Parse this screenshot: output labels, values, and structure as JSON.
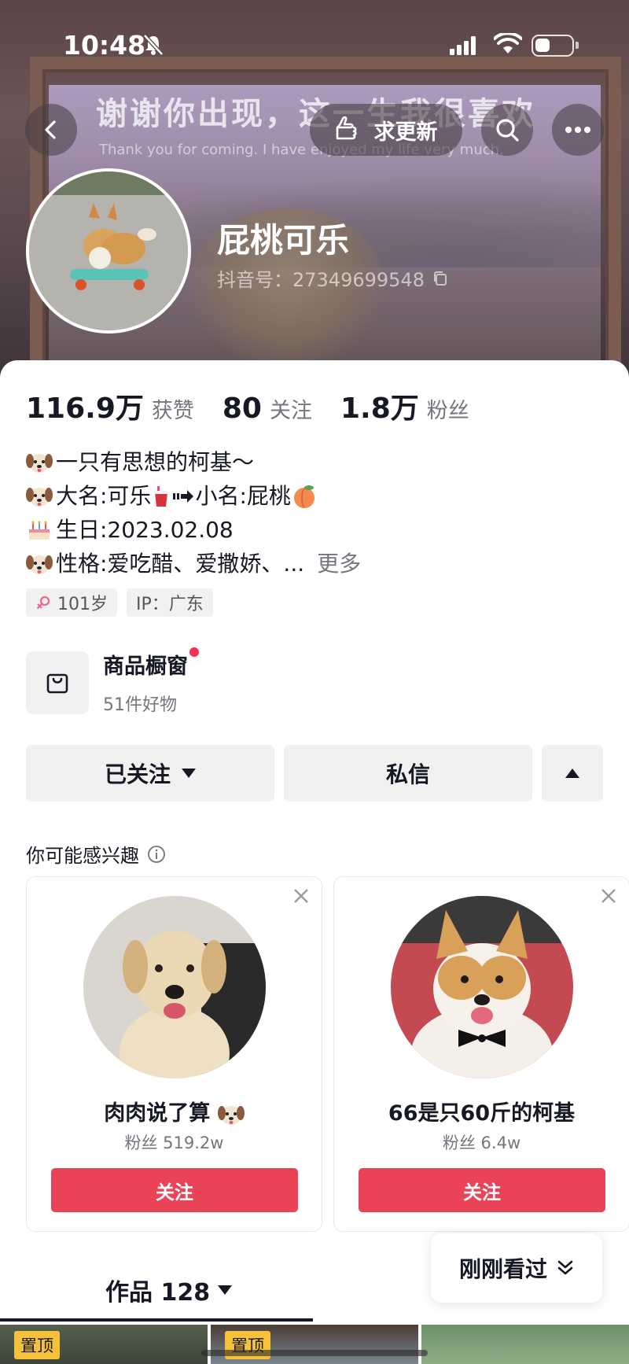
{
  "status_bar": {
    "time": "10:48"
  },
  "header": {
    "poster_title": "谢谢你出现，这一生我很喜欢",
    "poster_subtitle": "Thank you for coming. I have enjoyed my life very much.",
    "update_label": "求更新"
  },
  "profile": {
    "name": "屁桃可乐",
    "douyin_id": "抖音号：27349699548"
  },
  "stats": [
    {
      "value": "116.9万",
      "label": "获赞"
    },
    {
      "value": "80",
      "label": "关注"
    },
    {
      "value": "1.8万",
      "label": "粉丝"
    }
  ],
  "bio": {
    "line1": "一只有思想的柯基～",
    "line2_a": "大名:可乐",
    "line2_b": "小名:屁桃",
    "line3": "生日:2023.02.08",
    "line4": "性格:爱吃醋、爱撒娇、...",
    "more": "更多"
  },
  "tags": {
    "age": "101岁",
    "ip": "IP：广东"
  },
  "shop": {
    "title": "商品橱窗",
    "subtitle": "51件好物"
  },
  "actions": {
    "followed": "已关注",
    "message": "私信"
  },
  "recommend": {
    "title": "你可能感兴趣",
    "cards": [
      {
        "name": "肉肉说了算",
        "fans": "粉丝 519.2w",
        "follow": "关注"
      },
      {
        "name": "66是只60斤的柯基",
        "fans": "粉丝 6.4w",
        "follow": "关注"
      }
    ]
  },
  "just_viewed": "刚刚看过",
  "works": {
    "label": "作品 128"
  },
  "thumbs": {
    "pin": "置顶"
  },
  "colors": {
    "accent": "#ea4256",
    "text": "#161823",
    "secondary": "#75767d"
  }
}
